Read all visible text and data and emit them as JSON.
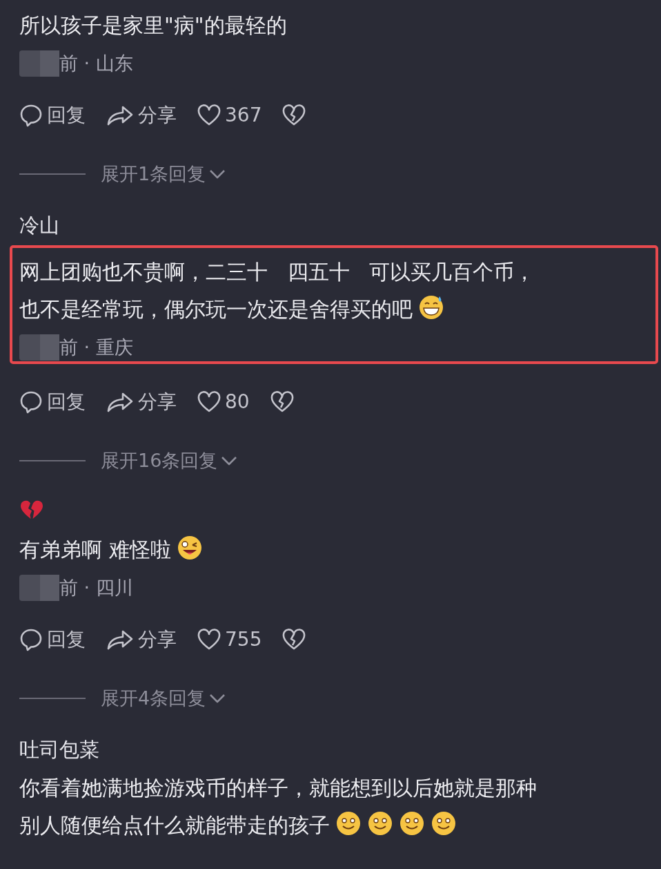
{
  "comments": [
    {
      "lines": [
        "所以孩子是家里\"病\"的最轻的"
      ],
      "meta": "前 · 山东",
      "reply": "回复",
      "share": "分享",
      "likes": "367",
      "expand": "展开1条回复",
      "highlighted": false
    },
    {
      "author": {
        "kind": "text",
        "name": "冷山"
      },
      "lines": [
        "网上团购也不贵啊，二三十   四五十   可以买几百个币，",
        "也不是经常玩，偶尔玩一次还是舍得买的吧"
      ],
      "emojis": [
        {
          "kind": "sweat-grin"
        }
      ],
      "meta": "前 · 重庆",
      "reply": "回复",
      "share": "分享",
      "likes": "80",
      "expand": "展开16条回复",
      "highlighted": true
    },
    {
      "author": {
        "kind": "icon"
      },
      "lines": [
        "有弟弟啊 难怪啦"
      ],
      "emojis": [
        {
          "kind": "wink-tongue"
        }
      ],
      "meta": "前 · 四川",
      "reply": "回复",
      "share": "分享",
      "likes": "755",
      "expand": "展开4条回复",
      "highlighted": false
    },
    {
      "author": {
        "kind": "text",
        "name": "吐司包菜"
      },
      "lines": [
        "你看着她满地捡游戏币的样子，就能想到以后她就是那种",
        "别人随便给点什么就能带走的孩子"
      ],
      "emojis": [
        {
          "kind": "smile"
        },
        {
          "kind": "smile"
        },
        {
          "kind": "smile"
        },
        {
          "kind": "smile"
        }
      ],
      "highlighted": false
    }
  ]
}
